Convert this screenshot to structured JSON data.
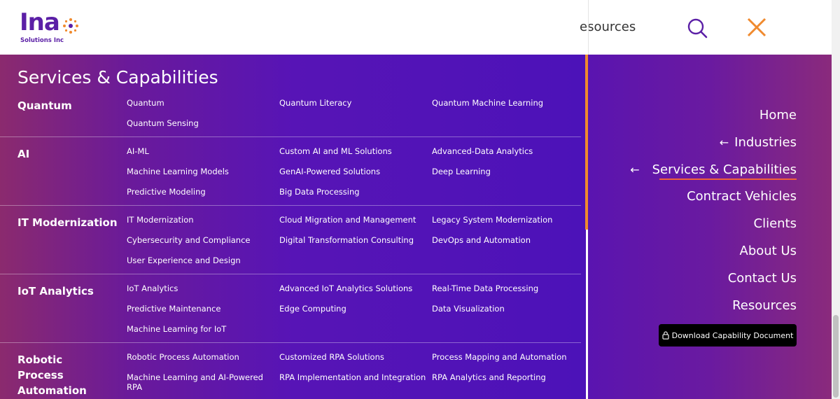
{
  "header": {
    "logo_text": "Ina",
    "logo_subtext": "Solutions Inc",
    "nav_peek_text": "esources",
    "search_icon": "search-icon",
    "close_icon": "close-icon",
    "brand_color": "#5b1fa6",
    "close_color": "#f08a2e"
  },
  "mega_menu": {
    "title": "Services & Capabilities",
    "categories": [
      {
        "name": "Quantum",
        "links": [
          "Quantum",
          "Quantum Literacy",
          "Quantum Machine Learning",
          "Quantum Sensing"
        ]
      },
      {
        "name": "AI",
        "links": [
          "AI-ML",
          "Custom AI and ML Solutions",
          "Advanced-Data Analytics",
          "Machine Learning Models",
          "GenAI-Powered Solutions",
          "Deep Learning",
          "Predictive Modeling",
          "Big Data Processing"
        ]
      },
      {
        "name": "IT Modernization",
        "links": [
          "IT Modernization",
          "Cloud Migration and Management",
          "Legacy System Modernization",
          "Cybersecurity and Compliance",
          "Digital Transformation Consulting",
          "DevOps and Automation",
          "User Experience and Design"
        ]
      },
      {
        "name": "IoT Analytics",
        "links": [
          "IoT Analytics",
          "Advanced IoT Analytics Solutions",
          "Real-Time Data Processing",
          "Predictive Maintenance",
          "Edge Computing",
          "Data Visualization",
          "Machine Learning for IoT"
        ]
      },
      {
        "name": "Robotic Process Automation",
        "links": [
          "Robotic Process Automation",
          "Customized RPA Solutions",
          "Process Mapping and Automation",
          "Machine Learning and AI-Powered RPA",
          "RPA Implementation and Integration",
          "RPA Analytics and Reporting"
        ]
      }
    ]
  },
  "side_nav": {
    "items": [
      {
        "label": "Home",
        "has_arrow": false
      },
      {
        "label": "Industries",
        "has_arrow": true
      },
      {
        "label": "Services & Capabilities",
        "has_arrow": true,
        "active": true
      },
      {
        "label": "Contract Vehicles",
        "has_arrow": false
      },
      {
        "label": "Clients",
        "has_arrow": false
      },
      {
        "label": "About Us",
        "has_arrow": false
      },
      {
        "label": "Contact Us",
        "has_arrow": false
      },
      {
        "label": "Resources",
        "has_arrow": false
      }
    ],
    "arrow_icon": "arrow-left-icon",
    "download_label": "Download Capability Document",
    "lock_icon": "lock-icon",
    "accent_color": "#f0603a"
  }
}
